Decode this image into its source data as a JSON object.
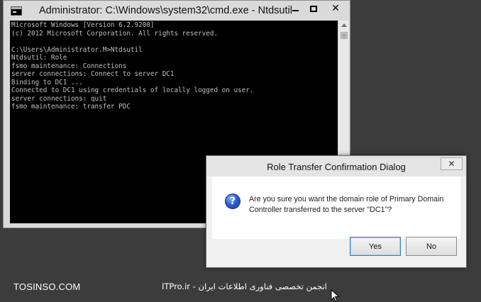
{
  "cmd_window": {
    "title": "Administrator: C:\\Windows\\system32\\cmd.exe - Ntdsutil",
    "minimize_glyph": "",
    "close_glyph": "✕",
    "lines": [
      "Microsoft Windows [Version 6.2.9200]",
      "(c) 2012 Microsoft Corporation. All rights reserved.",
      "",
      "C:\\Users\\Administrator.M>Ntdsutil",
      "Ntdsutil: Role",
      "fsmo maintenance: Connections",
      "server connections: Connect to server DC1",
      "Binding to DC1 ...",
      "Connected to DC1 using credentials of locally logged on user.",
      "server connections: quit",
      "fsmo maintenance: transfer PDC"
    ]
  },
  "dialog": {
    "title": "Role Transfer Confirmation Dialog",
    "close_glyph": "✕",
    "icon_glyph": "?",
    "message": "Are you sure you want the domain role of Primary Domain Controller transferred to the server \"DC1\"?",
    "yes_label": "Yes",
    "no_label": "No"
  },
  "watermark": {
    "left": "TOSINSO.COM",
    "center": "ITPro.ir - انجمن تخصصی فناوری اطلاعات ایران"
  }
}
